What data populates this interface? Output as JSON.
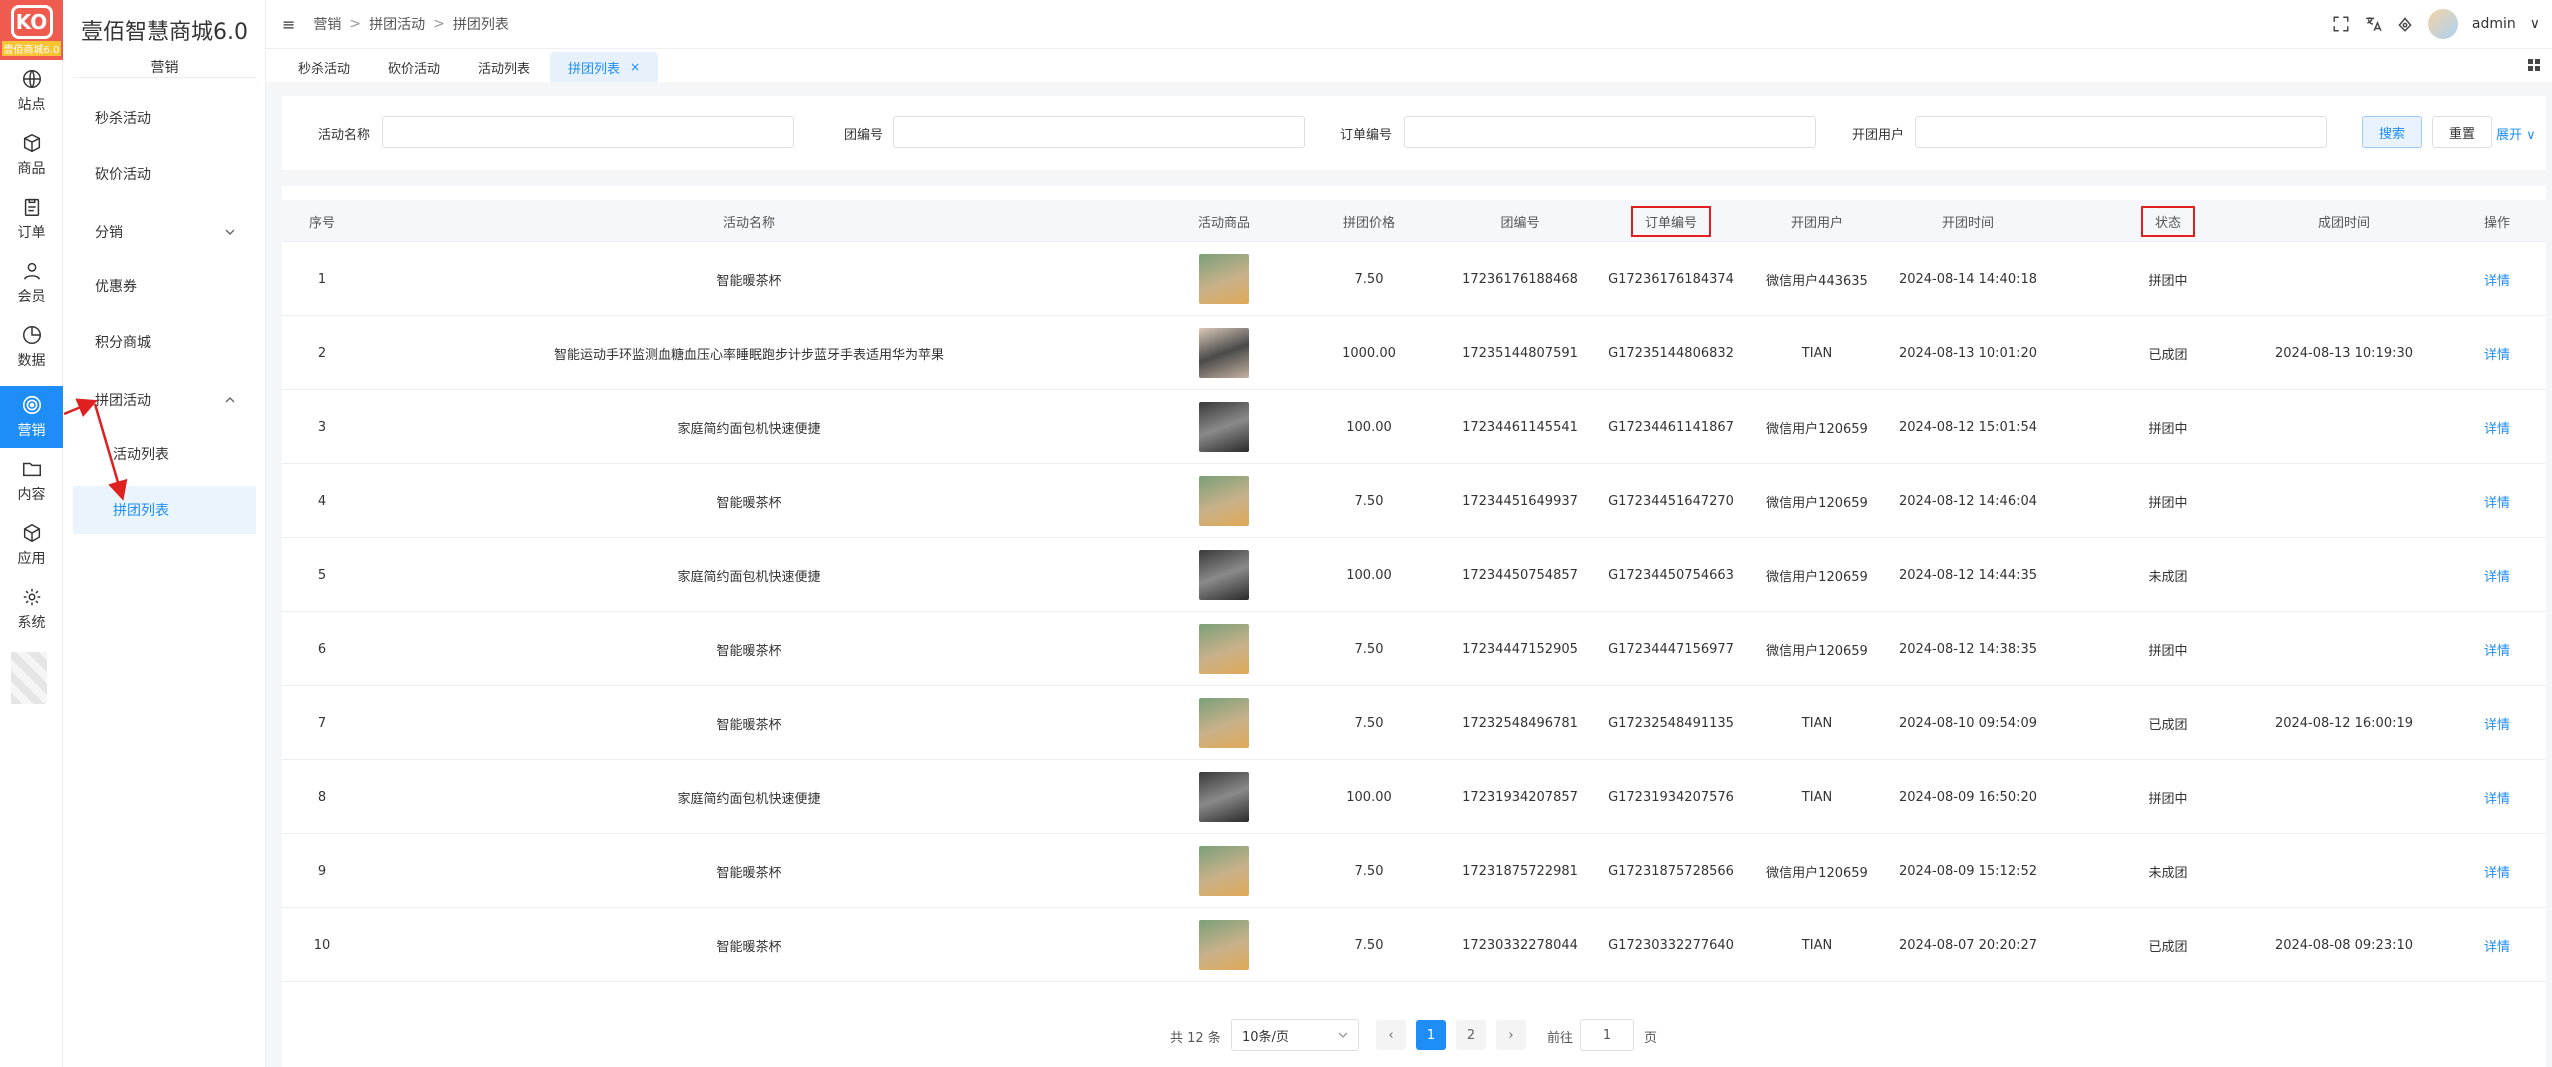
{
  "brand": {
    "logo_text": "KO",
    "logo_sub": "壹佰商城6.0"
  },
  "rail": [
    {
      "label": "站点",
      "icon": "globe-icon"
    },
    {
      "label": "商品",
      "icon": "box-icon"
    },
    {
      "label": "订单",
      "icon": "clipboard-icon"
    },
    {
      "label": "会员",
      "icon": "user-icon"
    },
    {
      "label": "数据",
      "icon": "pie-chart-icon"
    },
    {
      "label": "营销",
      "icon": "target-icon"
    },
    {
      "label": "内容",
      "icon": "folder-icon"
    },
    {
      "label": "应用",
      "icon": "cube-icon"
    },
    {
      "label": "系统",
      "icon": "gear-icon"
    }
  ],
  "sidebar": {
    "app_title": "壹佰智慧商城6.0",
    "section": "营销",
    "items": [
      {
        "label": "秒杀活动"
      },
      {
        "label": "砍价活动"
      },
      {
        "label": "分销",
        "chevron": "v"
      },
      {
        "label": "优惠券"
      },
      {
        "label": "积分商城"
      },
      {
        "label": "拼团活动",
        "chevron": "^"
      },
      {
        "label": "活动列表"
      },
      {
        "label": "拼团列表"
      }
    ]
  },
  "header": {
    "menu_icon": "≡",
    "breadcrumb": [
      "营销",
      "拼团活动",
      "拼团列表"
    ],
    "separator": ">",
    "user": "admin",
    "user_chevron": "∨"
  },
  "tabs": [
    {
      "label": "秒杀活动"
    },
    {
      "label": "砍价活动"
    },
    {
      "label": "活动列表"
    },
    {
      "label": "拼团列表",
      "close": "×"
    }
  ],
  "filters": {
    "activity_name_label": "活动名称",
    "group_no_label": "团编号",
    "order_no_label": "订单编号",
    "leader_label": "开团用户",
    "search_button": "搜索",
    "reset_button": "重置",
    "expand_label": "展开",
    "expand_chevron": "∨"
  },
  "table": {
    "columns": [
      "序号",
      "活动名称",
      "活动商品",
      "拼团价格",
      "团编号",
      "订单编号",
      "开团用户",
      "开团时间",
      "状态",
      "成团时间",
      "操作"
    ],
    "action_label": "详情",
    "rows": [
      {
        "no": "1",
        "name": "智能暖茶杯",
        "img": "tea",
        "price": "7.50",
        "group_no": "17236176188468",
        "order_no": "G17236176184374",
        "user": "微信用户443635",
        "open_time": "2024-08-14 14:40:18",
        "status": "拼团中",
        "done_time": ""
      },
      {
        "no": "2",
        "name": "智能运动手环监测血糖血压心率睡眠跑步计步蓝牙手表适用华为苹果",
        "img": "watch",
        "price": "1000.00",
        "group_no": "17235144807591",
        "order_no": "G17235144806832",
        "user": "TIAN",
        "open_time": "2024-08-13 10:01:20",
        "status": "已成团",
        "done_time": "2024-08-13 10:19:30"
      },
      {
        "no": "3",
        "name": "家庭简约面包机快速便捷",
        "img": "bread",
        "price": "100.00",
        "group_no": "17234461145541",
        "order_no": "G17234461141867",
        "user": "微信用户120659",
        "open_time": "2024-08-12 15:01:54",
        "status": "拼团中",
        "done_time": ""
      },
      {
        "no": "4",
        "name": "智能暖茶杯",
        "img": "tea",
        "price": "7.50",
        "group_no": "17234451649937",
        "order_no": "G17234451647270",
        "user": "微信用户120659",
        "open_time": "2024-08-12 14:46:04",
        "status": "拼团中",
        "done_time": ""
      },
      {
        "no": "5",
        "name": "家庭简约面包机快速便捷",
        "img": "bread",
        "price": "100.00",
        "group_no": "17234450754857",
        "order_no": "G17234450754663",
        "user": "微信用户120659",
        "open_time": "2024-08-12 14:44:35",
        "status": "未成团",
        "done_time": ""
      },
      {
        "no": "6",
        "name": "智能暖茶杯",
        "img": "tea",
        "price": "7.50",
        "group_no": "17234447152905",
        "order_no": "G17234447156977",
        "user": "微信用户120659",
        "open_time": "2024-08-12 14:38:35",
        "status": "拼团中",
        "done_time": ""
      },
      {
        "no": "7",
        "name": "智能暖茶杯",
        "img": "tea",
        "price": "7.50",
        "group_no": "17232548496781",
        "order_no": "G17232548491135",
        "user": "TIAN",
        "open_time": "2024-08-10 09:54:09",
        "status": "已成团",
        "done_time": "2024-08-12 16:00:19"
      },
      {
        "no": "8",
        "name": "家庭简约面包机快速便捷",
        "img": "bread",
        "price": "100.00",
        "group_no": "17231934207857",
        "order_no": "G17231934207576",
        "user": "TIAN",
        "open_time": "2024-08-09 16:50:20",
        "status": "拼团中",
        "done_time": ""
      },
      {
        "no": "9",
        "name": "智能暖茶杯",
        "img": "tea",
        "price": "7.50",
        "group_no": "17231875722981",
        "order_no": "G17231875728566",
        "user": "微信用户120659",
        "open_time": "2024-08-09 15:12:52",
        "status": "未成团",
        "done_time": ""
      },
      {
        "no": "10",
        "name": "智能暖茶杯",
        "img": "tea",
        "price": "7.50",
        "group_no": "17230332278044",
        "order_no": "G17230332277640",
        "user": "TIAN",
        "open_time": "2024-08-07 20:20:27",
        "status": "已成团",
        "done_time": "2024-08-08 09:23:10"
      }
    ]
  },
  "pagination": {
    "total_text": "共 12 条",
    "page_size": "10条/页",
    "prev": "‹",
    "next": "›",
    "pages": [
      "1",
      "2"
    ],
    "goto_label": "前往",
    "goto_value": "1",
    "page_suffix": "页"
  },
  "colors": {
    "accent": "#1e8df5",
    "logo": "#ef5b4f",
    "annotation": "#e02020"
  }
}
